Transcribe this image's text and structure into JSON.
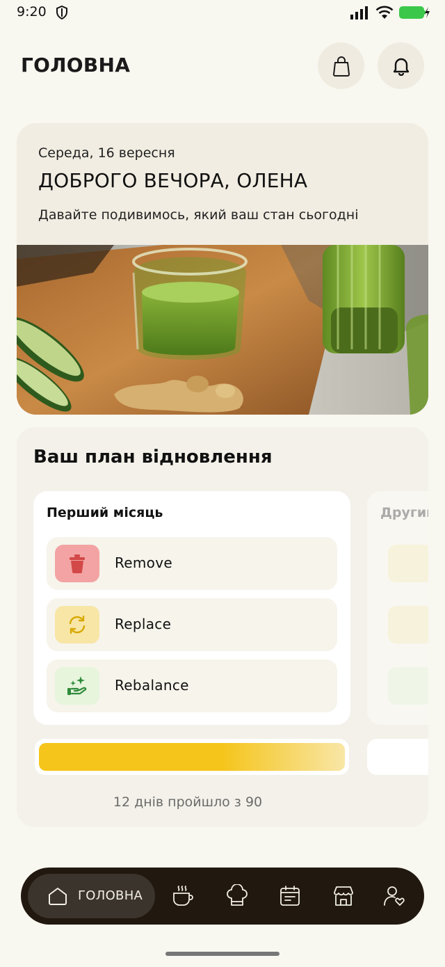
{
  "status": {
    "time": "9:20"
  },
  "header": {
    "title": "ГОЛОВНА"
  },
  "greeting": {
    "date": "Середа, 16 вересня",
    "title": "ДОБРОГО ВЕЧОРА, ОЛЕНА",
    "subtitle": "Давайте подивимось, який ваш стан сьогодні"
  },
  "plan": {
    "title": "Ваш план відновлення",
    "months": [
      {
        "label": "Перший місяць",
        "steps": [
          {
            "label": "Remove",
            "icon": "trash-icon",
            "color": "#f3a3a3"
          },
          {
            "label": "Replace",
            "icon": "refresh-icon",
            "color": "#f8e6a6"
          },
          {
            "label": "Rebalance",
            "icon": "hand-sparkle-icon",
            "color": "#e6f5dc"
          }
        ]
      },
      {
        "label": "Другий місяць"
      }
    ],
    "progress": {
      "days_passed": 12,
      "days_total": 90,
      "text": "12 днів пройшло з 90"
    }
  },
  "nav": {
    "active_label": "ГОЛОВНА",
    "items": [
      "home-icon",
      "coffee-cup-icon",
      "chef-hat-icon",
      "calendar-icon",
      "shop-icon",
      "profile-heart-icon"
    ]
  },
  "colors": {
    "background": "#f8f7f0",
    "accent_yellow": "#f5c51c",
    "nav_dark": "#21180f"
  }
}
